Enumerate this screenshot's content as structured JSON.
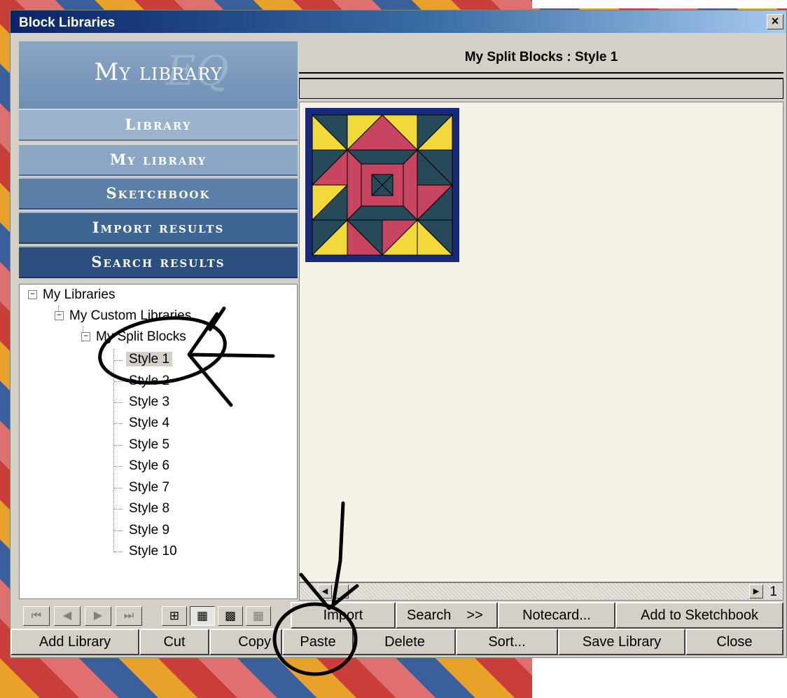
{
  "window": {
    "title": "Block Libraries",
    "close_glyph": "×"
  },
  "left_panel": {
    "header": "My library",
    "watermark": "EQ",
    "nav": [
      {
        "label": "Library"
      },
      {
        "label": "My library"
      },
      {
        "label": "Sketchbook"
      },
      {
        "label": "Import results"
      },
      {
        "label": "Search results"
      }
    ],
    "tree": {
      "root": "My Libraries",
      "child": "My Custom Libraries",
      "grandchild": "My Split Blocks",
      "styles": [
        "Style  1",
        "Style  2",
        "Style  3",
        "Style  4",
        "Style  5",
        "Style  6",
        "Style  7",
        "Style  8",
        "Style  9",
        "Style 10"
      ],
      "selected_index": 0
    }
  },
  "right_panel": {
    "header": "My Split Blocks  :  Style  1",
    "page_number": "1"
  },
  "block_colors": {
    "navy": "#1a2a7a",
    "teal": "#274a5a",
    "yellow": "#f2d93a",
    "rose": "#c74560"
  },
  "toolbar_row1": {
    "import": "Import",
    "search": "Search",
    "more": ">>",
    "notecard": "Notecard...",
    "add_sketchbook": "Add to Sketchbook"
  },
  "toolbar_row2": {
    "add_library": "Add Library",
    "cut": "Cut",
    "copy": "Copy",
    "paste": "Paste",
    "delete": "Delete",
    "sort": "Sort...",
    "save_library": "Save Library",
    "close": "Close"
  }
}
